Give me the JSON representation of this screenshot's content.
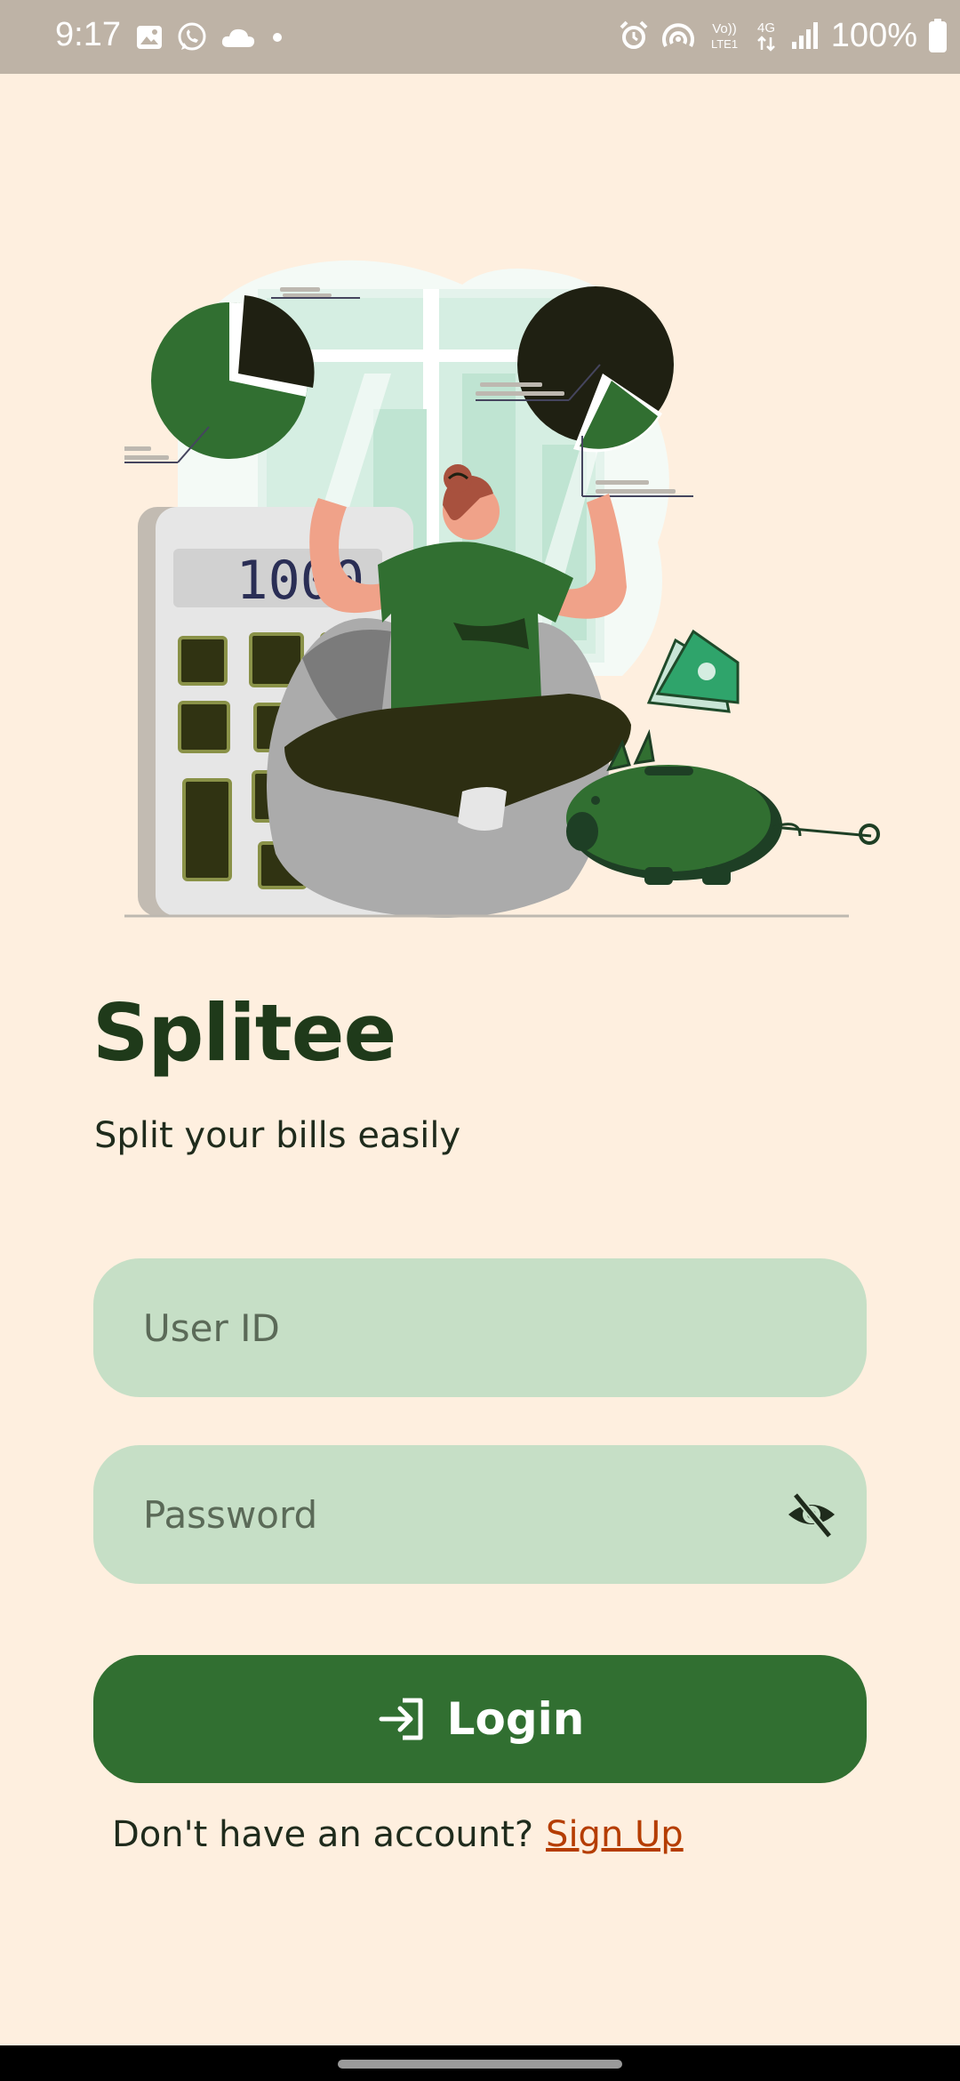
{
  "status_bar": {
    "time": "9:17",
    "battery": "100%",
    "left_icons": [
      "gallery-icon",
      "whatsapp-icon",
      "cloud-icon",
      "dot-icon"
    ],
    "right_icons": [
      "alarm-icon",
      "hotspot-icon",
      "volte-icon",
      "4g-icon",
      "signal-icon",
      "battery-icon"
    ],
    "volte_label": "Vo)) LTE1",
    "network_label": "4G"
  },
  "illustration": {
    "calculator_display": "1000"
  },
  "app": {
    "title": "Splitee",
    "subtitle": "Split your bills easily"
  },
  "form": {
    "user_id_placeholder": "User ID",
    "user_id_value": "",
    "password_placeholder": "Password",
    "password_value": "",
    "password_toggle_icon": "eye-off-icon",
    "login_label": "Login",
    "login_icon": "login-icon"
  },
  "signup": {
    "prompt": "Don't have an account?",
    "link": "Sign Up"
  },
  "colors": {
    "background": "#FEEFDF",
    "status_bar": "#BEB3A6",
    "field_fill": "#C6DFC6",
    "primary": "#316F31",
    "title": "#1F3A1A",
    "link": "#B53D00"
  }
}
